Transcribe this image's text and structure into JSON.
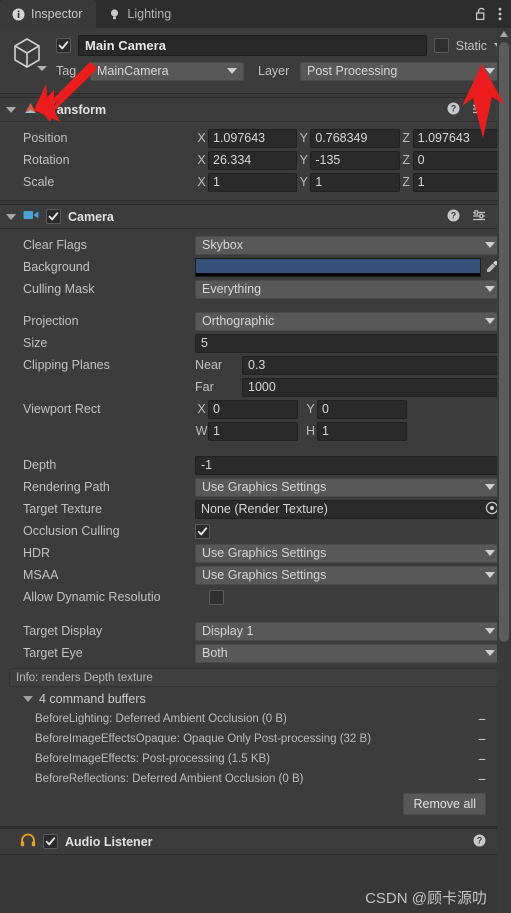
{
  "window": {
    "tabs": [
      {
        "label": "Inspector",
        "icon": "info-icon",
        "active": true
      },
      {
        "label": "Lighting",
        "icon": "lightbulb-icon",
        "active": false
      }
    ],
    "lock_icon": "lock-open-icon",
    "menu_icon": "kebab-menu-icon"
  },
  "object_header": {
    "type_icon": "prefab-cube-icon",
    "enabled": true,
    "name": "Main Camera",
    "static_label": "Static",
    "static_checked": false,
    "tag_label": "Tag",
    "tag_value": "MainCamera",
    "layer_label": "Layer",
    "layer_value": "Post Processing"
  },
  "transform": {
    "title": "Transform",
    "icon": "transform-icon",
    "help_icon": "help-icon",
    "preset_icon": "preset-icon",
    "menu_icon": "kebab-menu-icon",
    "rows": [
      {
        "label": "Position",
        "x": "1.097643",
        "y": "0.768349",
        "z": "1.097643"
      },
      {
        "label": "Rotation",
        "x": "26.334",
        "y": "-135",
        "z": "0"
      },
      {
        "label": "Scale",
        "x": "1",
        "y": "1",
        "z": "1"
      }
    ],
    "axis_labels": {
      "x": "X",
      "y": "Y",
      "z": "Z"
    }
  },
  "camera": {
    "title": "Camera",
    "icon": "camera-icon",
    "enabled": true,
    "help_icon": "help-icon",
    "preset_icon": "preset-icon",
    "menu_icon": "kebab-menu-icon",
    "clear_flags_label": "Clear Flags",
    "clear_flags_value": "Skybox",
    "background_label": "Background",
    "background_color": "#35507a",
    "eyedropper_icon": "eyedropper-icon",
    "culling_mask_label": "Culling Mask",
    "culling_mask_value": "Everything",
    "projection_label": "Projection",
    "projection_value": "Orthographic",
    "size_label": "Size",
    "size_value": "5",
    "clipping_label": "Clipping Planes",
    "near_label": "Near",
    "near_value": "0.3",
    "far_label": "Far",
    "far_value": "1000",
    "viewport_label": "Viewport Rect",
    "viewport_x_label": "X",
    "viewport_x_value": "0",
    "viewport_y_label": "Y",
    "viewport_y_value": "0",
    "viewport_w_label": "W",
    "viewport_w_value": "1",
    "viewport_h_label": "H",
    "viewport_h_value": "1",
    "depth_label": "Depth",
    "depth_value": "-1",
    "rendering_path_label": "Rendering Path",
    "rendering_path_value": "Use Graphics Settings",
    "target_texture_label": "Target Texture",
    "target_texture_value": "None (Render Texture)",
    "object_picker_icon": "object-picker-icon",
    "occlusion_label": "Occlusion Culling",
    "occlusion_checked": true,
    "hdr_label": "HDR",
    "hdr_value": "Use Graphics Settings",
    "msaa_label": "MSAA",
    "msaa_value": "Use Graphics Settings",
    "dynamic_res_label": "Allow Dynamic Resolutio",
    "dynamic_res_checked": false,
    "target_display_label": "Target Display",
    "target_display_value": "Display 1",
    "target_eye_label": "Target Eye",
    "target_eye_value": "Both",
    "info_text": "Info: renders Depth texture",
    "command_buffers_label": "4 command buffers",
    "command_buffers": [
      "BeforeLighting: Deferred Ambient Occlusion (0 B)",
      "BeforeImageEffectsOpaque: Opaque Only Post-processing (32 B)",
      "BeforeImageEffects: Post-processing (1.5 KB)",
      "BeforeReflections: Deferred Ambient Occlusion (0 B)"
    ],
    "remove_icon": "minus-icon",
    "remove_all_label": "Remove all"
  },
  "audio_listener": {
    "title": "Audio Listener",
    "icon": "headphones-icon",
    "enabled": true,
    "menu_icon": "kebab-menu-icon"
  },
  "watermark": "CSDN @顾卡源叻",
  "colors": {
    "panel": "#383838",
    "component": "#3c3c3c",
    "field": "#2a2a2a",
    "popup": "#585858",
    "accent_blue": "#35507a",
    "audio_icon": "#e8a317",
    "camera_icon": "#4aa3d8",
    "annotation_red": "#ee1c1c"
  }
}
